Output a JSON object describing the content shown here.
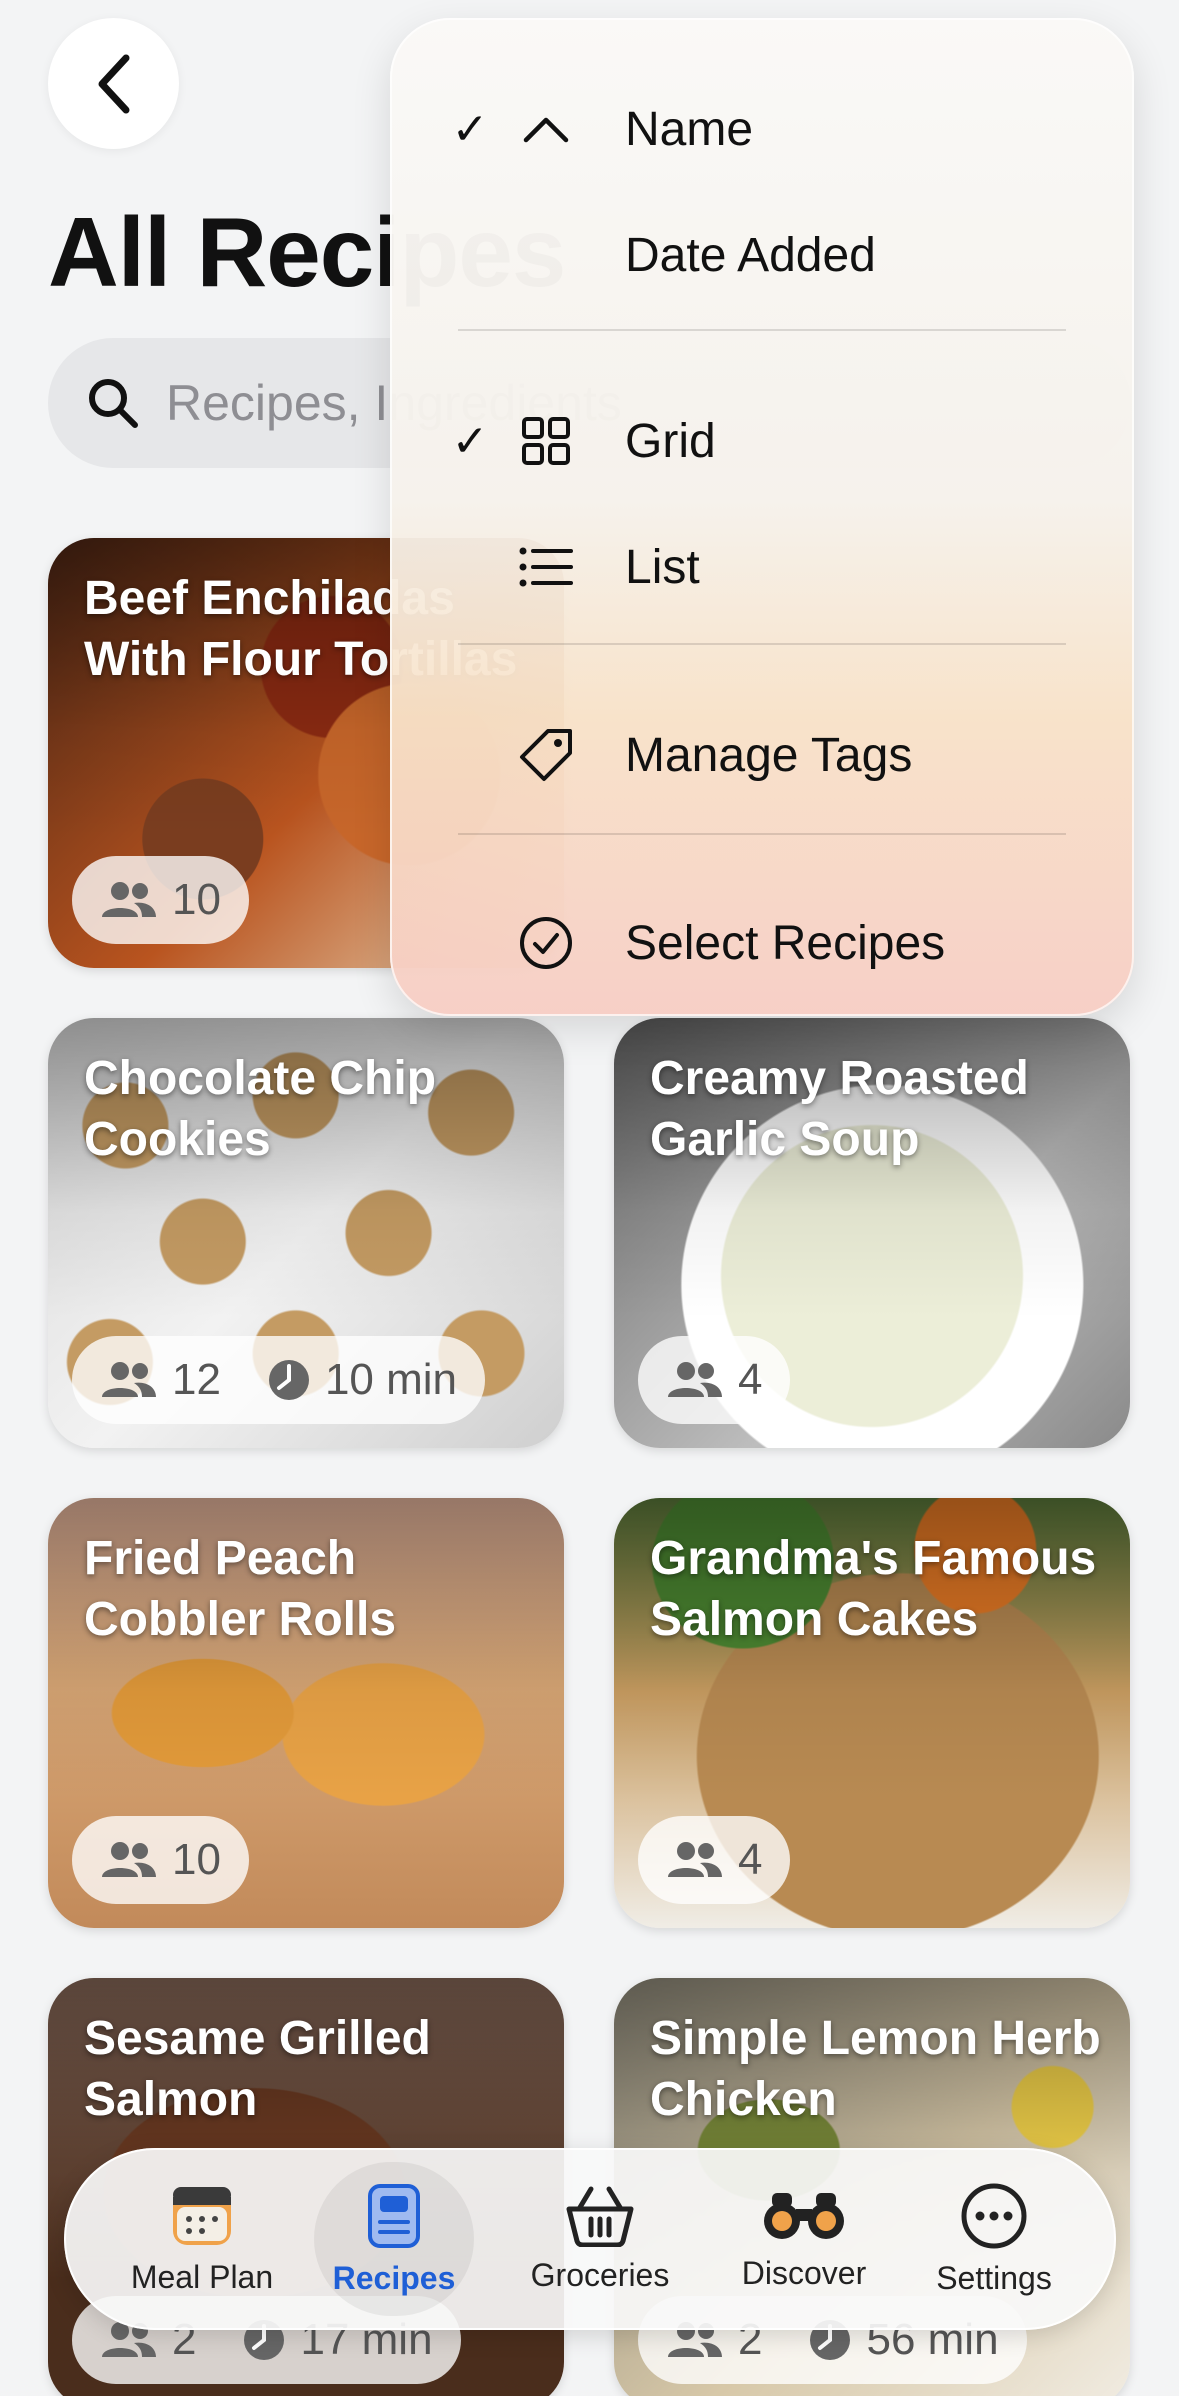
{
  "header": {
    "title": "All Recipes",
    "search_placeholder": "Recipes, Ingredients"
  },
  "menu": {
    "sort_items": [
      {
        "label": "Name",
        "checked": true,
        "icon": "chevron-up-icon"
      },
      {
        "label": "Date Added",
        "checked": false,
        "icon": ""
      }
    ],
    "view_items": [
      {
        "label": "Grid",
        "checked": true,
        "icon": "grid-icon"
      },
      {
        "label": "List",
        "checked": false,
        "icon": "list-icon"
      }
    ],
    "manage_tags": "Manage Tags",
    "select_recipes": "Select Recipes",
    "check_mark": "✓"
  },
  "recipes": [
    {
      "title": "Beef Enchiladas With Flour Tortillas",
      "servings": "10",
      "time": ""
    },
    {
      "title": "Chocolate Chip Cookies",
      "servings": "12",
      "time": "10 min"
    },
    {
      "title": "Creamy Roasted Garlic Soup",
      "servings": "4",
      "time": ""
    },
    {
      "title": "Fried Peach Cobbler Rolls",
      "servings": "10",
      "time": ""
    },
    {
      "title": "Grandma's Famous Salmon Cakes",
      "servings": "4",
      "time": ""
    },
    {
      "title": "Sesame Grilled Salmon",
      "servings": "2",
      "time": "17 min"
    },
    {
      "title": "Simple Lemon Herb Chicken",
      "servings": "2",
      "time": "56 min"
    }
  ],
  "tabbar": {
    "tabs": [
      {
        "label": "Meal Plan",
        "icon": "meal-plan-icon",
        "active": false
      },
      {
        "label": "Recipes",
        "icon": "recipes-icon",
        "active": true
      },
      {
        "label": "Groceries",
        "icon": "basket-icon",
        "active": false
      },
      {
        "label": "Discover",
        "icon": "binoculars-icon",
        "active": false
      },
      {
        "label": "Settings",
        "icon": "ellipsis-icon",
        "active": false
      }
    ]
  },
  "colors": {
    "accent": "#1f5fd6",
    "background": "#f3f4f5"
  }
}
